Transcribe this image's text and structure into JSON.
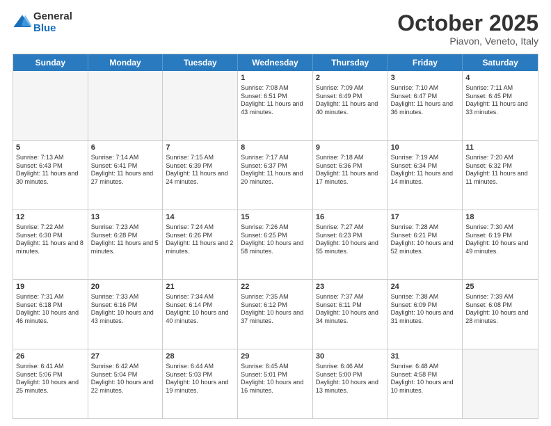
{
  "header": {
    "logo_line1": "General",
    "logo_line2": "Blue",
    "month": "October 2025",
    "location": "Piavon, Veneto, Italy"
  },
  "weekdays": [
    "Sunday",
    "Monday",
    "Tuesday",
    "Wednesday",
    "Thursday",
    "Friday",
    "Saturday"
  ],
  "rows": [
    [
      {
        "day": "",
        "info": ""
      },
      {
        "day": "",
        "info": ""
      },
      {
        "day": "",
        "info": ""
      },
      {
        "day": "1",
        "info": "Sunrise: 7:08 AM\nSunset: 6:51 PM\nDaylight: 11 hours and 43 minutes."
      },
      {
        "day": "2",
        "info": "Sunrise: 7:09 AM\nSunset: 6:49 PM\nDaylight: 11 hours and 40 minutes."
      },
      {
        "day": "3",
        "info": "Sunrise: 7:10 AM\nSunset: 6:47 PM\nDaylight: 11 hours and 36 minutes."
      },
      {
        "day": "4",
        "info": "Sunrise: 7:11 AM\nSunset: 6:45 PM\nDaylight: 11 hours and 33 minutes."
      }
    ],
    [
      {
        "day": "5",
        "info": "Sunrise: 7:13 AM\nSunset: 6:43 PM\nDaylight: 11 hours and 30 minutes."
      },
      {
        "day": "6",
        "info": "Sunrise: 7:14 AM\nSunset: 6:41 PM\nDaylight: 11 hours and 27 minutes."
      },
      {
        "day": "7",
        "info": "Sunrise: 7:15 AM\nSunset: 6:39 PM\nDaylight: 11 hours and 24 minutes."
      },
      {
        "day": "8",
        "info": "Sunrise: 7:17 AM\nSunset: 6:37 PM\nDaylight: 11 hours and 20 minutes."
      },
      {
        "day": "9",
        "info": "Sunrise: 7:18 AM\nSunset: 6:36 PM\nDaylight: 11 hours and 17 minutes."
      },
      {
        "day": "10",
        "info": "Sunrise: 7:19 AM\nSunset: 6:34 PM\nDaylight: 11 hours and 14 minutes."
      },
      {
        "day": "11",
        "info": "Sunrise: 7:20 AM\nSunset: 6:32 PM\nDaylight: 11 hours and 11 minutes."
      }
    ],
    [
      {
        "day": "12",
        "info": "Sunrise: 7:22 AM\nSunset: 6:30 PM\nDaylight: 11 hours and 8 minutes."
      },
      {
        "day": "13",
        "info": "Sunrise: 7:23 AM\nSunset: 6:28 PM\nDaylight: 11 hours and 5 minutes."
      },
      {
        "day": "14",
        "info": "Sunrise: 7:24 AM\nSunset: 6:26 PM\nDaylight: 11 hours and 2 minutes."
      },
      {
        "day": "15",
        "info": "Sunrise: 7:26 AM\nSunset: 6:25 PM\nDaylight: 10 hours and 58 minutes."
      },
      {
        "day": "16",
        "info": "Sunrise: 7:27 AM\nSunset: 6:23 PM\nDaylight: 10 hours and 55 minutes."
      },
      {
        "day": "17",
        "info": "Sunrise: 7:28 AM\nSunset: 6:21 PM\nDaylight: 10 hours and 52 minutes."
      },
      {
        "day": "18",
        "info": "Sunrise: 7:30 AM\nSunset: 6:19 PM\nDaylight: 10 hours and 49 minutes."
      }
    ],
    [
      {
        "day": "19",
        "info": "Sunrise: 7:31 AM\nSunset: 6:18 PM\nDaylight: 10 hours and 46 minutes."
      },
      {
        "day": "20",
        "info": "Sunrise: 7:33 AM\nSunset: 6:16 PM\nDaylight: 10 hours and 43 minutes."
      },
      {
        "day": "21",
        "info": "Sunrise: 7:34 AM\nSunset: 6:14 PM\nDaylight: 10 hours and 40 minutes."
      },
      {
        "day": "22",
        "info": "Sunrise: 7:35 AM\nSunset: 6:12 PM\nDaylight: 10 hours and 37 minutes."
      },
      {
        "day": "23",
        "info": "Sunrise: 7:37 AM\nSunset: 6:11 PM\nDaylight: 10 hours and 34 minutes."
      },
      {
        "day": "24",
        "info": "Sunrise: 7:38 AM\nSunset: 6:09 PM\nDaylight: 10 hours and 31 minutes."
      },
      {
        "day": "25",
        "info": "Sunrise: 7:39 AM\nSunset: 6:08 PM\nDaylight: 10 hours and 28 minutes."
      }
    ],
    [
      {
        "day": "26",
        "info": "Sunrise: 6:41 AM\nSunset: 5:06 PM\nDaylight: 10 hours and 25 minutes."
      },
      {
        "day": "27",
        "info": "Sunrise: 6:42 AM\nSunset: 5:04 PM\nDaylight: 10 hours and 22 minutes."
      },
      {
        "day": "28",
        "info": "Sunrise: 6:44 AM\nSunset: 5:03 PM\nDaylight: 10 hours and 19 minutes."
      },
      {
        "day": "29",
        "info": "Sunrise: 6:45 AM\nSunset: 5:01 PM\nDaylight: 10 hours and 16 minutes."
      },
      {
        "day": "30",
        "info": "Sunrise: 6:46 AM\nSunset: 5:00 PM\nDaylight: 10 hours and 13 minutes."
      },
      {
        "day": "31",
        "info": "Sunrise: 6:48 AM\nSunset: 4:58 PM\nDaylight: 10 hours and 10 minutes."
      },
      {
        "day": "",
        "info": ""
      }
    ]
  ]
}
